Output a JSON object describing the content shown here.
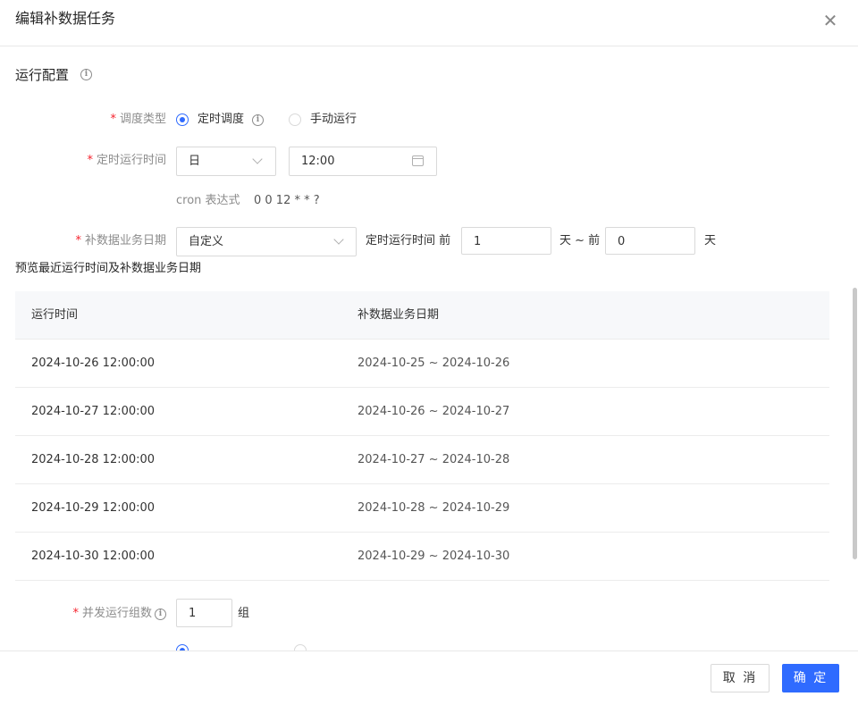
{
  "dialog": {
    "title": "编辑补数据任务"
  },
  "section": {
    "title": "运行配置"
  },
  "schedule_type": {
    "label": "调度类型",
    "options": [
      "定时调度",
      "手动运行"
    ],
    "selected": "定时调度"
  },
  "run_time": {
    "label": "定时运行时间",
    "period": "日",
    "time": "12:00"
  },
  "cron": {
    "label": "cron 表达式",
    "value": "0 0 12 * * ?"
  },
  "biz_date": {
    "label": "补数据业务日期",
    "mode": "自定义",
    "prefix": "定时运行时间 前",
    "from_days": "1",
    "middle": "天 ~ 前",
    "to_days": "0",
    "suffix": "天"
  },
  "preview": {
    "title": "预览最近运行时间及补数据业务日期",
    "columns": [
      "运行时间",
      "补数据业务日期"
    ],
    "rows": [
      [
        "2024-10-26 12:00:00",
        "2024-10-25 ~ 2024-10-26"
      ],
      [
        "2024-10-27 12:00:00",
        "2024-10-26 ~ 2024-10-27"
      ],
      [
        "2024-10-28 12:00:00",
        "2024-10-27 ~ 2024-10-28"
      ],
      [
        "2024-10-29 12:00:00",
        "2024-10-28 ~ 2024-10-29"
      ],
      [
        "2024-10-30 12:00:00",
        "2024-10-29 ~ 2024-10-30"
      ]
    ]
  },
  "concurrency": {
    "label": "并发运行组数",
    "value": "1",
    "unit": "组"
  },
  "footer": {
    "cancel": "取 消",
    "ok": "确 定"
  },
  "colors": {
    "primary": "#2f6bff",
    "required": "#f5222d"
  }
}
